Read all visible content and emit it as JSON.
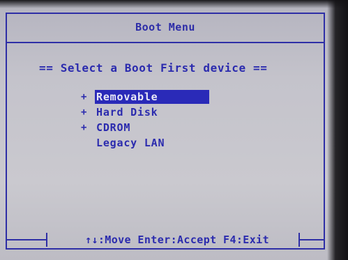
{
  "window": {
    "title": "Boot Menu"
  },
  "menu": {
    "heading": "== Select a Boot First device ==",
    "items": [
      {
        "expander": "+",
        "label": "Removable",
        "selected": true
      },
      {
        "expander": "+",
        "label": "Hard Disk",
        "selected": false
      },
      {
        "expander": "+",
        "label": "CDROM",
        "selected": false
      },
      {
        "expander": "",
        "label": "Legacy LAN",
        "selected": false
      }
    ]
  },
  "footer": {
    "hint": "↑↓:Move Enter:Accept F4:Exit"
  },
  "colors": {
    "text": "#2b2bae",
    "highlight_bg": "#2a2ab8",
    "highlight_text": "#e8e8f6",
    "screen_bg": "#c4c3cb"
  }
}
